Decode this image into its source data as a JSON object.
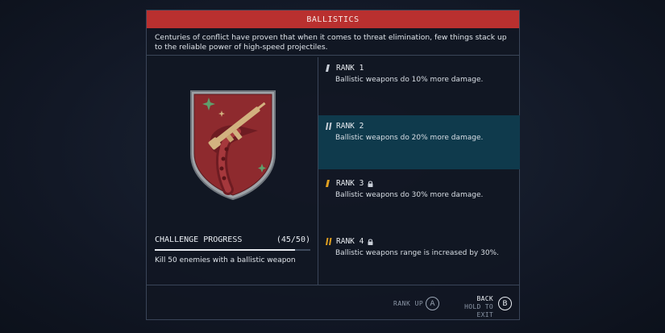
{
  "header": {
    "title": "BALLISTICS"
  },
  "description": "Centuries of conflict have proven that when it comes to threat elimination, few things stack up to the reliable power of high-speed projectiles.",
  "challenge": {
    "title": "CHALLENGE PROGRESS",
    "count": "(45/50)",
    "progress": 0.9,
    "description": "Kill 50 enemies with a ballistic weapon"
  },
  "ranks": [
    {
      "label": "RANK 1",
      "description": "Ballistic weapons do 10% more damage.",
      "locked": false,
      "active": false,
      "icon": "rank-1-icon"
    },
    {
      "label": "RANK 2",
      "description": "Ballistic weapons do 20% more damage.",
      "locked": false,
      "active": true,
      "icon": "rank-2-icon"
    },
    {
      "label": "RANK 3",
      "description": "Ballistic weapons do 30% more damage.",
      "locked": true,
      "active": false,
      "icon": "rank-3-icon"
    },
    {
      "label": "RANK 4",
      "description": "Ballistic weapons range is increased by 30%.",
      "locked": true,
      "active": false,
      "icon": "rank-4-icon"
    }
  ],
  "footer": {
    "rank_up_label": "RANK UP",
    "rank_up_button": "A",
    "back_label": "BACK",
    "hold_label": "HOLD TO EXIT",
    "back_button": "B"
  },
  "colors": {
    "header": "#b9302f",
    "active_rank": "#0f3a4c",
    "rank_locked_accent": "#e0a020",
    "emblem_red": "#8e2a2e"
  }
}
